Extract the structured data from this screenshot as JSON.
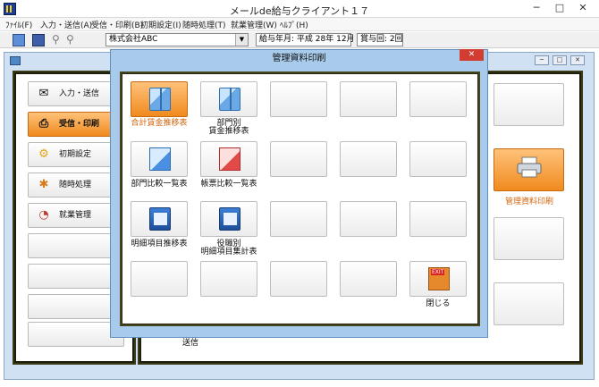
{
  "window": {
    "title": "メールde給与クライアント１７",
    "minimize": "─",
    "maximize": "□",
    "close": "✕"
  },
  "menu": [
    "ﾌｧｲﾙ(F)",
    "入力・送信(A)",
    "受信・印刷(B)",
    "初期設定(I)",
    "随時処理(T)",
    "就業管理(W)",
    "ﾍﾙﾌﾟ(H)"
  ],
  "toolbar": {
    "company": "株式会社ABC",
    "pay_date_label": "給与年月:",
    "pay_date_value": "平成 28年 12月",
    "bonus_label": "賞与回:",
    "bonus_value": "2回"
  },
  "child_controls": {
    "minimize": "─",
    "maximize": "□",
    "close": "✕"
  },
  "nav": [
    {
      "label": "入力・送信",
      "icon": "envelope-icon",
      "active": false
    },
    {
      "label": "受信・印刷",
      "icon": "printer-icon",
      "active": true
    },
    {
      "label": "初期設定",
      "icon": "gear-icon",
      "active": false
    },
    {
      "label": "随時処理",
      "icon": "puzzle-icon",
      "active": false
    },
    {
      "label": "就業管理",
      "icon": "clock-icon",
      "active": false
    }
  ],
  "right_panel": {
    "active_label": "管理資料印刷"
  },
  "dialog": {
    "title": "管理資料印刷",
    "close": "✕",
    "buttons": [
      {
        "label": "合計賃金推移表",
        "icon": "book-chart-icon",
        "active": true
      },
      {
        "label": "部門別\n賃金推移表",
        "icon": "book-chart-icon",
        "active": false
      },
      {
        "label": "部門比較一覧表",
        "icon": "pencil-document-icon",
        "active": false
      },
      {
        "label": "帳票比較一覧表",
        "icon": "pencil-document-red-icon",
        "active": false
      },
      {
        "label": "明細項目推移表",
        "icon": "screen-document-icon",
        "active": false
      },
      {
        "label": "役職別\n明細項目集計表",
        "icon": "screen-document-user-icon",
        "active": false
      },
      {
        "label": "閉じる",
        "icon": "exit-door-icon",
        "active": false
      }
    ]
  },
  "bottom_text": "送信"
}
